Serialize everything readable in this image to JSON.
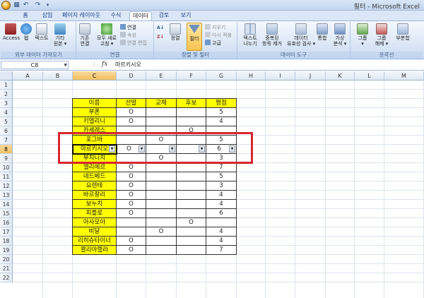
{
  "window": {
    "title": "필터 - Microsoft Excel"
  },
  "quick_access": {
    "save_icon": "save-icon",
    "undo_icon": "undo-icon",
    "redo_icon": "redo-icon"
  },
  "tabs": [
    "홈",
    "삽입",
    "페이지 레이아웃",
    "수식",
    "데이터",
    "검토",
    "보기"
  ],
  "active_tab_index": 4,
  "ribbon": {
    "groups": {
      "external": "외부 데이터 가져오기",
      "connections": "연결",
      "sort_filter": "정렬 및 필터",
      "data_tools": "데이터 도구",
      "outline": "윤곽선"
    },
    "buttons": {
      "access": "Access",
      "web": "웹",
      "text": "텍스트",
      "other_sources": [
        "기타",
        "원본 ▾"
      ],
      "existing_connections": [
        "기존",
        "연결"
      ],
      "refresh_all": [
        "모두 새로",
        "고침 ▾"
      ],
      "connections": "연결",
      "properties": "속성",
      "edit_links": "연결 편집",
      "sort_az": "↓",
      "sort_za": "↓",
      "sort": "정렬",
      "filter": "필터",
      "clear": "지우기",
      "reapply": "다시 적용",
      "advanced": "고급",
      "text_to_columns": [
        "텍스트",
        "나누기"
      ],
      "remove_duplicates": [
        "중복된",
        "항목 제거"
      ],
      "data_validation": [
        "데이터",
        "유효성 검사 ▾"
      ],
      "consolidate": "통합",
      "what_if": [
        "가상",
        "분석 ▾"
      ],
      "group": [
        "그룹",
        "▾"
      ],
      "ungroup": [
        "그룹",
        "해제 ▾"
      ],
      "subtotal": "부분합"
    }
  },
  "formula_bar": {
    "name_box": "C8",
    "fx": "fx",
    "value": "마르키시오"
  },
  "sheet": {
    "columns": [
      "A",
      "B",
      "C",
      "D",
      "E",
      "F",
      "G",
      "H",
      "I",
      "J",
      "K",
      "L",
      "M"
    ],
    "rows": [
      "1",
      "2",
      "3",
      "4",
      "5",
      "6",
      "7",
      "8",
      "9",
      "10",
      "11",
      "12",
      "13",
      "14",
      "15",
      "16",
      "17",
      "18",
      "19",
      "20",
      "21",
      "22"
    ],
    "selected_column": "C",
    "selected_row": "8",
    "table": {
      "headers": [
        "이름",
        "선발",
        "교체",
        "후보",
        "평점"
      ],
      "filter_row_index": 4,
      "rows": [
        [
          "부폰",
          "O",
          "",
          "",
          "5"
        ],
        [
          "키엘리니",
          "O",
          "",
          "",
          "4"
        ],
        [
          "카세레스",
          "",
          "",
          "O",
          ""
        ],
        [
          "포그바",
          "",
          "O",
          "",
          "5"
        ],
        [
          "마르키시오",
          "O",
          "",
          "",
          "6"
        ],
        [
          "부치니치",
          "",
          "O",
          "",
          "3"
        ],
        [
          "엘리에르",
          "O",
          "",
          "",
          "7"
        ],
        [
          "네드베드",
          "O",
          "",
          "",
          "5"
        ],
        [
          "요렌테",
          "O",
          "",
          "",
          "3"
        ],
        [
          "바르잘리",
          "O",
          "",
          "",
          "4"
        ],
        [
          "보누치",
          "O",
          "",
          "",
          "4"
        ],
        [
          "피를로",
          "O",
          "",
          "",
          "6"
        ],
        [
          "아사모아",
          "",
          "",
          "O",
          ""
        ],
        [
          "비달",
          "",
          "O",
          "",
          "4"
        ],
        [
          "리히슈타이너",
          "O",
          "",
          "",
          "4"
        ],
        [
          "콸리아렐라",
          "O",
          "",
          "",
          "7"
        ]
      ]
    },
    "colors": {
      "name_fill": "#ffff00",
      "highlight_border": "#d8262f",
      "selection_header": "#f1c15f"
    }
  }
}
